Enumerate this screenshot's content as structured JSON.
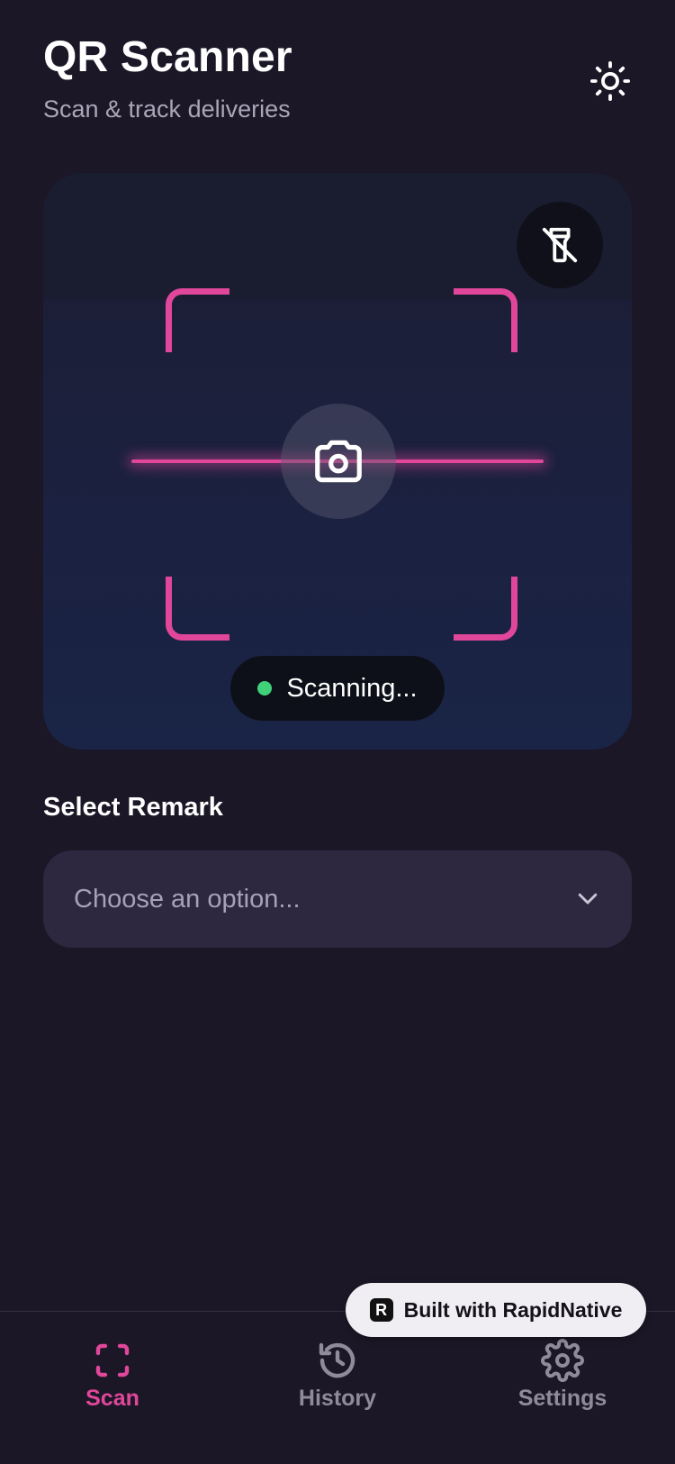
{
  "header": {
    "title": "QR Scanner",
    "subtitle": "Scan & track deliveries",
    "theme_icon": "sun-icon"
  },
  "scanner": {
    "flash_icon": "flashlight-off-icon",
    "camera_icon": "camera-icon",
    "status_text": "Scanning...",
    "status_color": "#3fd27a",
    "accent_color": "#e0479a"
  },
  "remark": {
    "label": "Select Remark",
    "placeholder": "Choose an option..."
  },
  "tabs": [
    {
      "label": "Scan",
      "icon": "scan-icon",
      "active": true
    },
    {
      "label": "History",
      "icon": "history-icon",
      "active": false
    },
    {
      "label": "Settings",
      "icon": "settings-icon",
      "active": false
    }
  ],
  "badge": {
    "text": "Built with RapidNative"
  }
}
